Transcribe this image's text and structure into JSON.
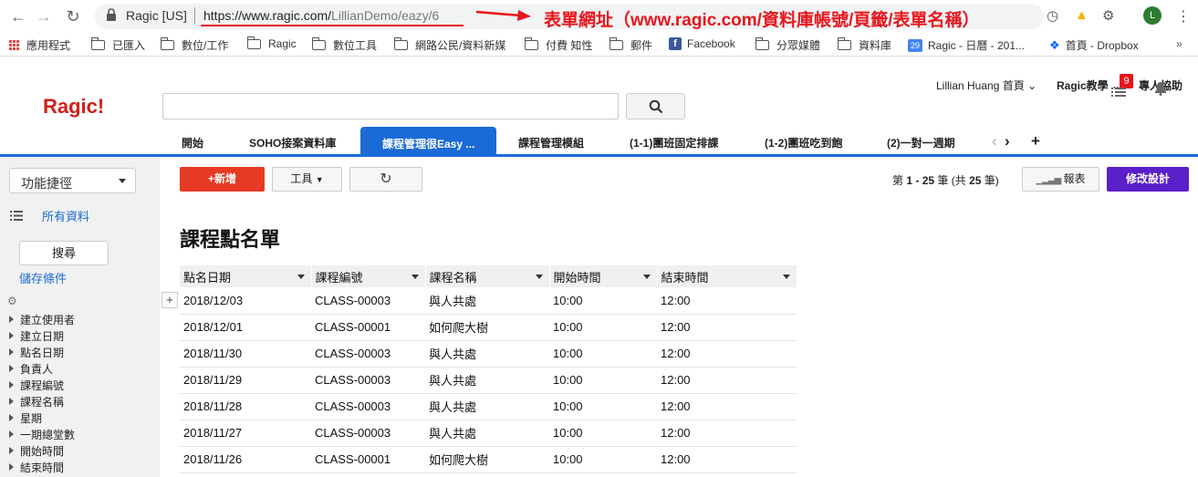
{
  "browser": {
    "site_label": "Ragic [US]",
    "url_host": "https://www.ragic.com/",
    "url_path": "LillianDemo/eazy/6",
    "annotation": "表單網址（www.ragic.com/資料庫帳號/頁籤/表單名稱）",
    "avatar_letter": "L"
  },
  "bookmarks": [
    "應用程式",
    "已匯入",
    "數位/工作",
    "Ragic",
    "數位工具",
    "網路公民/資料新媒",
    "付費 知性",
    "郵件",
    "Facebook",
    "分眾媒體",
    "資料庫",
    "Ragic - 日曆 - 201...",
    "首頁 - Dropbox"
  ],
  "bookmark_more": "»",
  "calendar_day": "29",
  "header": {
    "logo": "Ragic!",
    "user_home": "Lillian Huang 首頁",
    "tutorial": "Ragic教學",
    "help": "專人協助"
  },
  "tabs": [
    "開始",
    "SOHO接案資料庫",
    "課程管理很Easy ...",
    "課程管理模組",
    "(1-1)團班固定排課",
    "(1-2)團班吃到飽",
    "(2)一對一週期"
  ],
  "active_tab": 2,
  "notification_count": "9",
  "sidebar": {
    "shortcut_label": "功能捷徑",
    "all_data": "所有資料",
    "search_button": "搜尋",
    "save_conditions": "儲存條件",
    "filters": [
      "建立使用者",
      "建立日期",
      "點名日期",
      "負責人",
      "課程編號",
      "課程名稱",
      "星期",
      "一期總堂數",
      "開始時間",
      "結束時間"
    ]
  },
  "toolbar": {
    "new_label": "+新增",
    "tools_label": "工具",
    "pager_prefix": "第",
    "pager_range": "1 - 25",
    "pager_mid": "筆 (共",
    "pager_total": "25",
    "pager_suffix": "筆)",
    "report_label": "報表",
    "design_label": "修改設計"
  },
  "page_title": "課程點名單",
  "table": {
    "columns": [
      "點名日期",
      "課程編號",
      "課程名稱",
      "開始時間",
      "結束時間"
    ],
    "rows": [
      [
        "2018/12/03",
        "CLASS-00003",
        "與人共處",
        "10:00",
        "12:00"
      ],
      [
        "2018/12/01",
        "CLASS-00001",
        "如何爬大樹",
        "10:00",
        "12:00"
      ],
      [
        "2018/11/30",
        "CLASS-00003",
        "與人共處",
        "10:00",
        "12:00"
      ],
      [
        "2018/11/29",
        "CLASS-00003",
        "與人共處",
        "10:00",
        "12:00"
      ],
      [
        "2018/11/28",
        "CLASS-00003",
        "與人共處",
        "10:00",
        "12:00"
      ],
      [
        "2018/11/27",
        "CLASS-00003",
        "與人共處",
        "10:00",
        "12:00"
      ],
      [
        "2018/11/26",
        "CLASS-00001",
        "如何爬大樹",
        "10:00",
        "12:00"
      ]
    ]
  },
  "colors": {
    "brand_red": "#d0201a",
    "tab_blue": "#1a6bd6",
    "new_button": "#e63a24",
    "design_button": "#5a1fc8",
    "annotation_red": "#e8151b"
  }
}
